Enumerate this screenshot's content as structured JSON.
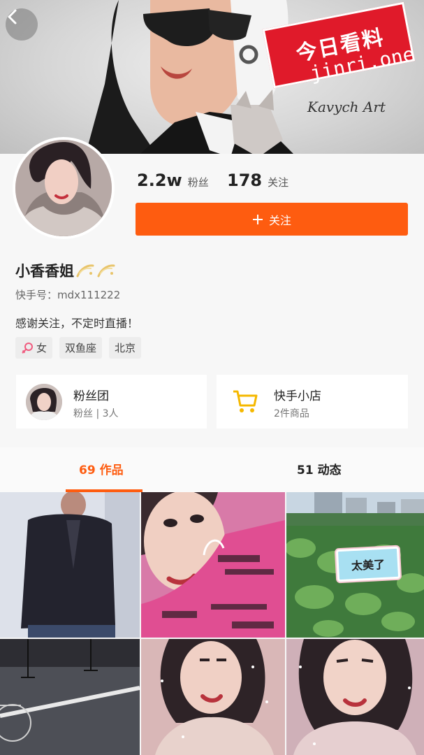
{
  "banner": {
    "signature": "Kavych Art"
  },
  "watermark": {
    "title": "今日看料",
    "subtitle": "jinri.one"
  },
  "profile": {
    "fans_count": "2.2w",
    "fans_label": "粉丝",
    "following_count": "178",
    "following_label": "关注",
    "follow_button": "关注",
    "nickname": "小香香姐",
    "kuaishou_id": "快手号：mdx111222",
    "bio": "感谢关注，不定时直播！",
    "tags": {
      "gender": "女",
      "zodiac": "双鱼座",
      "city": "北京"
    }
  },
  "fan_group": {
    "title": "粉丝团",
    "subtitle": "粉丝 | 3人"
  },
  "shop": {
    "title": "快手小店",
    "subtitle": "2件商品"
  },
  "tabs": {
    "works": {
      "count": "69",
      "label": "作品",
      "active": true
    },
    "moments": {
      "count": "51",
      "label": "动态",
      "active": false
    }
  },
  "grid": {
    "lotus_sticker": "太美了"
  },
  "colors": {
    "accent": "#fe5c10",
    "watermark_red": "#e01a2a",
    "shop_icon": "#f5b800"
  }
}
